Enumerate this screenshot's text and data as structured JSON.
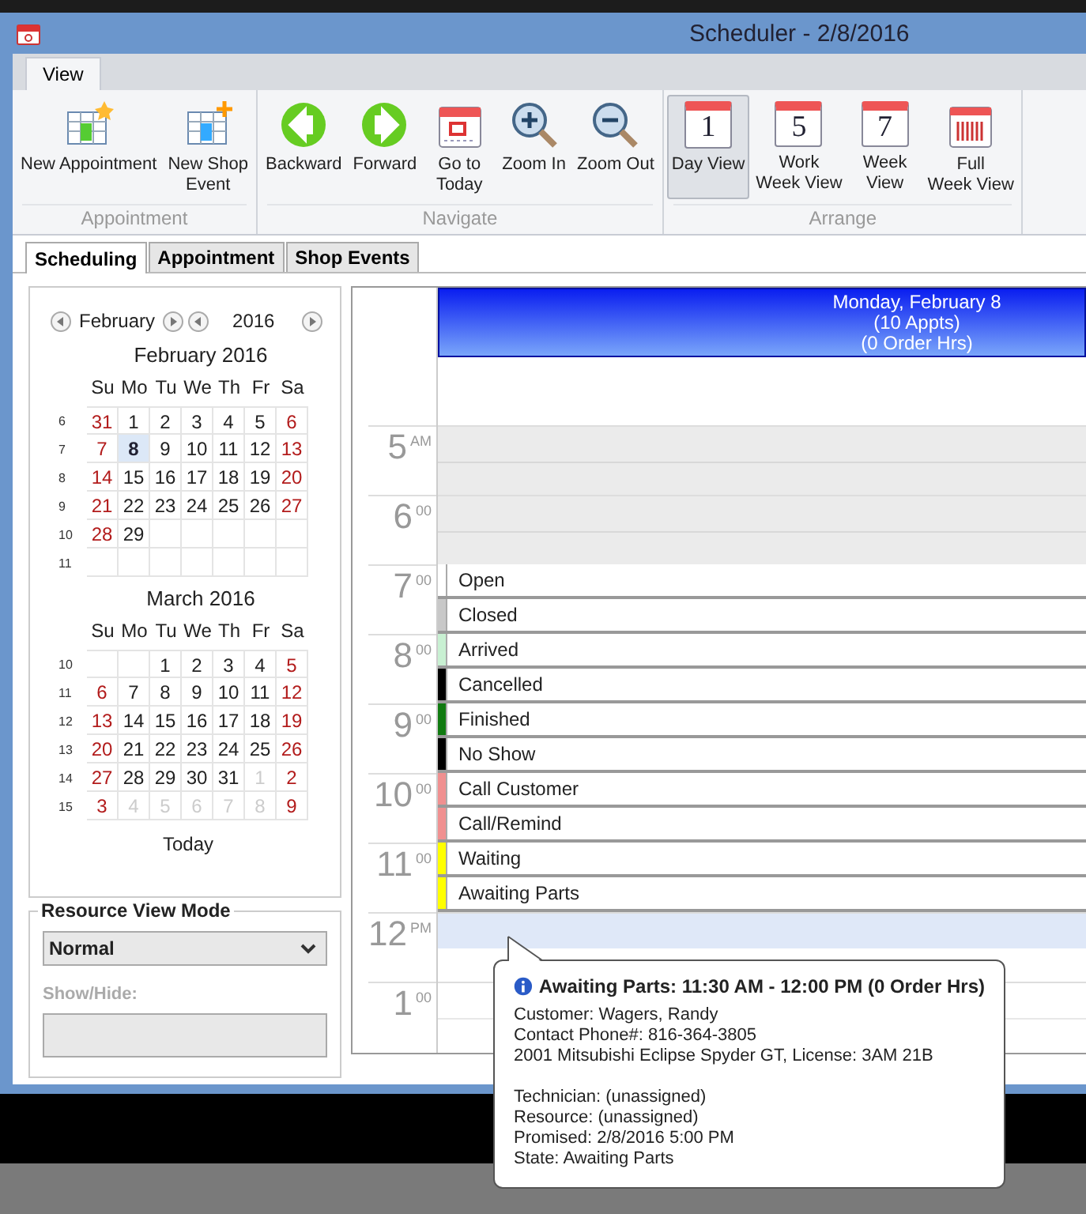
{
  "window": {
    "title": "Scheduler - 2/8/2016"
  },
  "ribbon_tabs": [
    {
      "label": "View",
      "selected": true
    }
  ],
  "ribbon_groups": [
    {
      "label": "Appointment",
      "buttons": [
        {
          "label": "New Appointment",
          "kind": "new-appointment",
          "selected": false
        },
        {
          "label": "New Shop\nEvent",
          "kind": "new-event",
          "selected": false
        }
      ]
    },
    {
      "label": "Navigate",
      "buttons": [
        {
          "label": "Backward",
          "kind": "backward",
          "selected": false
        },
        {
          "label": "Forward",
          "kind": "forward",
          "selected": false
        },
        {
          "label": "Go to\nToday",
          "kind": "today",
          "selected": false
        },
        {
          "label": "Zoom In",
          "kind": "zoom-in",
          "selected": false
        },
        {
          "label": "Zoom Out",
          "kind": "zoom-out",
          "selected": false
        }
      ]
    },
    {
      "label": "Arrange",
      "buttons": [
        {
          "label": "Day View",
          "kind": "calendar",
          "icon_text": "1",
          "selected": true
        },
        {
          "label": "Work\nWeek View",
          "kind": "calendar",
          "icon_text": "5",
          "selected": false
        },
        {
          "label": "Week\nView",
          "kind": "calendar",
          "icon_text": "7",
          "selected": false
        },
        {
          "label": "Full\nWeek View",
          "kind": "full-week",
          "selected": false
        }
      ]
    }
  ],
  "doc_tabs": [
    {
      "label": "Scheduling",
      "selected": true
    },
    {
      "label": "Appointment",
      "selected": false
    },
    {
      "label": "Shop Events",
      "selected": false
    }
  ],
  "calendar_nav": {
    "month": "February",
    "year": "2016"
  },
  "months": [
    {
      "title": "February 2016",
      "weekdays": [
        "Su",
        "Mo",
        "Tu",
        "We",
        "Th",
        "Fr",
        "Sa"
      ],
      "weeks": [
        {
          "number": "6",
          "days": [
            {
              "label": "31",
              "kind": "weekend",
              "selected": false
            },
            {
              "label": "1",
              "kind": "weekday",
              "selected": false
            },
            {
              "label": "2",
              "kind": "weekday",
              "selected": false
            },
            {
              "label": "3",
              "kind": "weekday",
              "selected": false
            },
            {
              "label": "4",
              "kind": "weekday",
              "selected": false
            },
            {
              "label": "5",
              "kind": "weekday",
              "selected": false
            },
            {
              "label": "6",
              "kind": "weekend",
              "selected": false
            }
          ]
        },
        {
          "number": "7",
          "days": [
            {
              "label": "7",
              "kind": "weekend",
              "selected": false
            },
            {
              "label": "8",
              "kind": "weekday",
              "selected": true
            },
            {
              "label": "9",
              "kind": "weekday",
              "selected": false
            },
            {
              "label": "10",
              "kind": "weekday",
              "selected": false
            },
            {
              "label": "11",
              "kind": "weekday",
              "selected": false
            },
            {
              "label": "12",
              "kind": "weekday",
              "selected": false
            },
            {
              "label": "13",
              "kind": "weekend",
              "selected": false
            }
          ]
        },
        {
          "number": "8",
          "days": [
            {
              "label": "14",
              "kind": "weekend",
              "selected": false
            },
            {
              "label": "15",
              "kind": "weekday",
              "selected": false
            },
            {
              "label": "16",
              "kind": "weekday",
              "selected": false
            },
            {
              "label": "17",
              "kind": "weekday",
              "selected": false
            },
            {
              "label": "18",
              "kind": "weekday",
              "selected": false
            },
            {
              "label": "19",
              "kind": "weekday",
              "selected": false
            },
            {
              "label": "20",
              "kind": "weekend",
              "selected": false
            }
          ]
        },
        {
          "number": "9",
          "days": [
            {
              "label": "21",
              "kind": "weekend",
              "selected": false
            },
            {
              "label": "22",
              "kind": "weekday",
              "selected": false
            },
            {
              "label": "23",
              "kind": "weekday",
              "selected": false
            },
            {
              "label": "24",
              "kind": "weekday",
              "selected": false
            },
            {
              "label": "25",
              "kind": "weekday",
              "selected": false
            },
            {
              "label": "26",
              "kind": "weekday",
              "selected": false
            },
            {
              "label": "27",
              "kind": "weekend",
              "selected": false
            }
          ]
        },
        {
          "number": "10",
          "days": [
            {
              "label": "28",
              "kind": "weekend",
              "selected": false
            },
            {
              "label": "29",
              "kind": "weekday",
              "selected": false
            },
            {
              "kind": "empty"
            },
            {
              "kind": "empty"
            },
            {
              "kind": "empty"
            },
            {
              "kind": "empty"
            },
            {
              "kind": "empty"
            }
          ]
        },
        {
          "number": "11",
          "days": [
            {
              "kind": "empty"
            },
            {
              "kind": "empty"
            },
            {
              "kind": "empty"
            },
            {
              "kind": "empty"
            },
            {
              "kind": "empty"
            },
            {
              "kind": "empty"
            },
            {
              "kind": "empty"
            }
          ]
        }
      ]
    },
    {
      "title": "March 2016",
      "weekdays": [
        "Su",
        "Mo",
        "Tu",
        "We",
        "Th",
        "Fr",
        "Sa"
      ],
      "weeks": [
        {
          "number": "10",
          "days": [
            {
              "kind": "empty"
            },
            {
              "kind": "empty"
            },
            {
              "label": "1",
              "kind": "weekday",
              "selected": false
            },
            {
              "label": "2",
              "kind": "weekday",
              "selected": false
            },
            {
              "label": "3",
              "kind": "weekday",
              "selected": false
            },
            {
              "label": "4",
              "kind": "weekday",
              "selected": false
            },
            {
              "label": "5",
              "kind": "weekend",
              "selected": false
            }
          ]
        },
        {
          "number": "11",
          "days": [
            {
              "label": "6",
              "kind": "weekend",
              "selected": false
            },
            {
              "label": "7",
              "kind": "weekday",
              "selected": false
            },
            {
              "label": "8",
              "kind": "weekday",
              "selected": false
            },
            {
              "label": "9",
              "kind": "weekday",
              "selected": false
            },
            {
              "label": "10",
              "kind": "weekday",
              "selected": false
            },
            {
              "label": "11",
              "kind": "weekday",
              "selected": false
            },
            {
              "label": "12",
              "kind": "weekend",
              "selected": false
            }
          ]
        },
        {
          "number": "12",
          "days": [
            {
              "label": "13",
              "kind": "weekend",
              "selected": false
            },
            {
              "label": "14",
              "kind": "weekday",
              "selected": false
            },
            {
              "label": "15",
              "kind": "weekday",
              "selected": false
            },
            {
              "label": "16",
              "kind": "weekday",
              "selected": false
            },
            {
              "label": "17",
              "kind": "weekday",
              "selected": false
            },
            {
              "label": "18",
              "kind": "weekday",
              "selected": false
            },
            {
              "label": "19",
              "kind": "weekend",
              "selected": false
            }
          ]
        },
        {
          "number": "13",
          "days": [
            {
              "label": "20",
              "kind": "weekend",
              "selected": false
            },
            {
              "label": "21",
              "kind": "weekday",
              "selected": false
            },
            {
              "label": "22",
              "kind": "weekday",
              "selected": false
            },
            {
              "label": "23",
              "kind": "weekday",
              "selected": false
            },
            {
              "label": "24",
              "kind": "weekday",
              "selected": false
            },
            {
              "label": "25",
              "kind": "weekday",
              "selected": false
            },
            {
              "label": "26",
              "kind": "weekend",
              "selected": false
            }
          ]
        },
        {
          "number": "14",
          "days": [
            {
              "label": "27",
              "kind": "weekend",
              "selected": false
            },
            {
              "label": "28",
              "kind": "weekday",
              "selected": false
            },
            {
              "label": "29",
              "kind": "weekday",
              "selected": false
            },
            {
              "label": "30",
              "kind": "weekday",
              "selected": false
            },
            {
              "label": "31",
              "kind": "weekday",
              "selected": false
            },
            {
              "label": "1",
              "kind": "other",
              "selected": false
            },
            {
              "label": "2",
              "kind": "weekend",
              "selected": false
            }
          ]
        },
        {
          "number": "15",
          "days": [
            {
              "label": "3",
              "kind": "weekend",
              "selected": false
            },
            {
              "label": "4",
              "kind": "other",
              "selected": false
            },
            {
              "label": "5",
              "kind": "other",
              "selected": false
            },
            {
              "label": "6",
              "kind": "other",
              "selected": false
            },
            {
              "label": "7",
              "kind": "other",
              "selected": false
            },
            {
              "label": "8",
              "kind": "other",
              "selected": false
            },
            {
              "label": "9",
              "kind": "weekend",
              "selected": false
            }
          ]
        }
      ]
    }
  ],
  "today_link": "Today",
  "resource_panel": {
    "title": "Resource View Mode",
    "mode": "Normal",
    "show_hide_label": "Show/Hide:",
    "show_hide_disabled": true
  },
  "day_header": {
    "lines": [
      "Monday, February 8",
      "(10 Appts)",
      "(0 Order Hrs)"
    ]
  },
  "hours": [
    {
      "hour": "5",
      "suffix": "AM",
      "working": false,
      "highlighted": false
    },
    {
      "hour": "6",
      "suffix": "00",
      "working": false,
      "highlighted": false
    },
    {
      "hour": "7",
      "suffix": "00",
      "working": true,
      "highlighted": false,
      "appointments": [
        {
          "label": "Open",
          "color": "#ffffff"
        },
        {
          "label": "Closed",
          "color": "#c8c8c8"
        }
      ]
    },
    {
      "hour": "8",
      "suffix": "00",
      "working": true,
      "highlighted": false,
      "appointments": [
        {
          "label": "Arrived",
          "color": "#c8f0d2"
        },
        {
          "label": "Cancelled",
          "color": "#000000"
        }
      ]
    },
    {
      "hour": "9",
      "suffix": "00",
      "working": true,
      "highlighted": false,
      "appointments": [
        {
          "label": "Finished",
          "color": "#107a10"
        },
        {
          "label": "No Show",
          "color": "#000000"
        }
      ]
    },
    {
      "hour": "10",
      "suffix": "00",
      "working": true,
      "highlighted": false,
      "appointments": [
        {
          "label": "Call Customer",
          "color": "#f09090"
        },
        {
          "label": "Call/Remind",
          "color": "#f09090"
        }
      ]
    },
    {
      "hour": "11",
      "suffix": "00",
      "working": true,
      "highlighted": false,
      "appointments": [
        {
          "label": "Waiting",
          "color": "#ffff00"
        },
        {
          "label": "Awaiting Parts",
          "color": "#ffff00"
        }
      ]
    },
    {
      "hour": "12",
      "suffix": "PM",
      "working": true,
      "highlighted": true
    },
    {
      "hour": "1",
      "suffix": "00",
      "working": true,
      "highlighted": false
    }
  ],
  "tooltip": {
    "title": "Awaiting Parts: 11:30 AM - 12:00 PM (0 Order Hrs)",
    "paragraphs": [
      [
        "Customer: Wagers, Randy",
        "Contact Phone#: 816-364-3805",
        "2001 Mitsubishi Eclipse Spyder GT, License: 3AM 21B"
      ],
      [
        "Technician: (unassigned)",
        "Resource: (unassigned)",
        "Promised: 2/8/2016 5:00 PM",
        "State: Awaiting Parts"
      ]
    ]
  }
}
